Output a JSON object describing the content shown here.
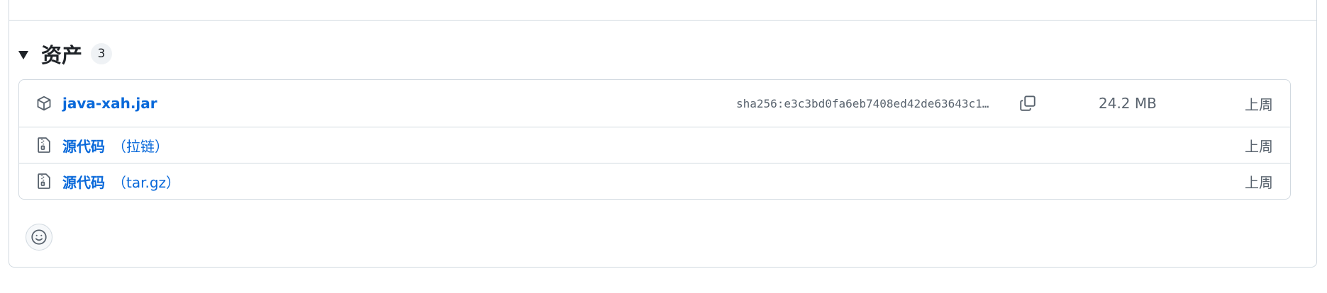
{
  "assets": {
    "title": "资产",
    "count": "3",
    "items": [
      {
        "icon": "package-icon",
        "name": "java-xah.jar",
        "suffix": "",
        "sha": "sha256:e3c3bd0fa6eb7408ed42de63643c1…",
        "size": "24.2 MB",
        "time": "上周"
      },
      {
        "icon": "file-zip-icon",
        "name": "源代码",
        "suffix": "（拉链）",
        "time": "上周"
      },
      {
        "icon": "file-zip-icon",
        "name": "源代码",
        "suffix": "（tar.gz）",
        "time": "上周"
      }
    ]
  },
  "reaction": {
    "icon": "smiley-icon"
  }
}
